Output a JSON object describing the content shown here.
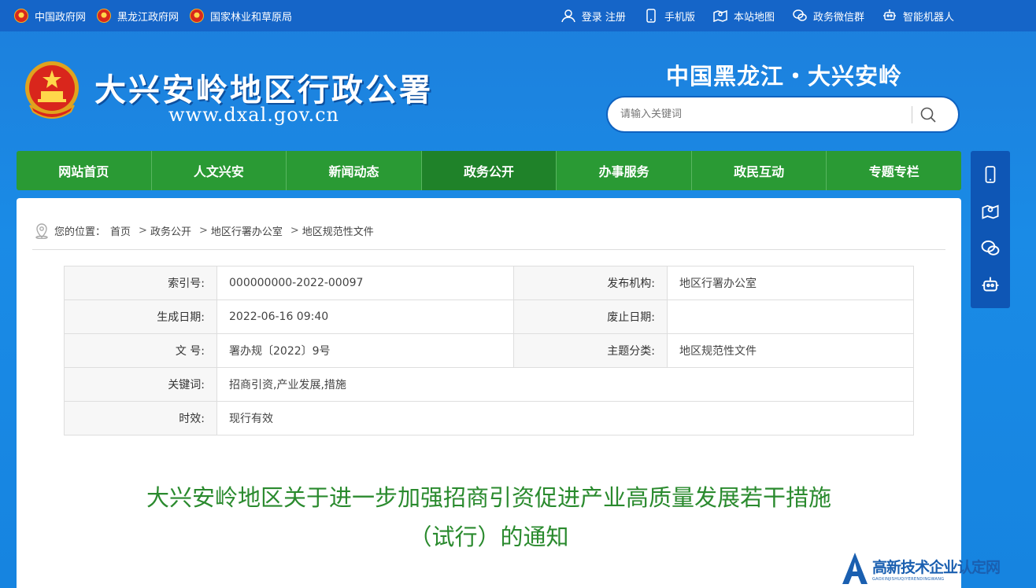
{
  "topbar": {
    "links": [
      "中国政府网",
      "黑龙江政府网",
      "国家林业和草原局"
    ],
    "right": {
      "login": "登录 注册",
      "mobile": "手机版",
      "sitemap": "本站地图",
      "wechat": "政务微信群",
      "robot": "智能机器人"
    }
  },
  "header": {
    "site_title": "大兴安岭地区行政公署",
    "site_url": "www.dxal.gov.cn",
    "region_title": "中国黑龙江・大兴安岭",
    "search_placeholder": "请输入关键词"
  },
  "nav": [
    "网站首页",
    "人文兴安",
    "新闻动态",
    "政务公开",
    "办事服务",
    "政民互动",
    "专题专栏"
  ],
  "breadcrumb": {
    "prefix": "您的位置：",
    "items": [
      "首页",
      "政务公开",
      "地区行署办公室",
      "地区规范性文件"
    ]
  },
  "meta": {
    "index_label": "索引号:",
    "index_value": "000000000-2022-00097",
    "publisher_label": "发布机构:",
    "publisher_value": "地区行署办公室",
    "date_label": "生成日期:",
    "date_value": "2022-06-16 09:40",
    "expire_label": "废止日期:",
    "expire_value": "",
    "docno_label": "文 号:",
    "docno_value": "署办规〔2022〕9号",
    "topic_label": "主题分类:",
    "topic_value": "地区规范性文件",
    "keywords_label": "关键词:",
    "keywords_value": "招商引资,产业发展,措施",
    "validity_label": "时效:",
    "validity_value": "现行有效"
  },
  "document": {
    "title_line1": "大兴安岭地区关于进一步加强招商引资促进产业高质量发展若干措施",
    "title_line2": "（试行）的通知"
  },
  "watermark": {
    "main": "高新技术企业认定网",
    "sub": "GAOXINJISHUQIYERENDINGWANG"
  },
  "colors": {
    "nav_green": "#2a9a34",
    "title_green": "#2a8a2e",
    "header_blue": "#1a8be6"
  }
}
